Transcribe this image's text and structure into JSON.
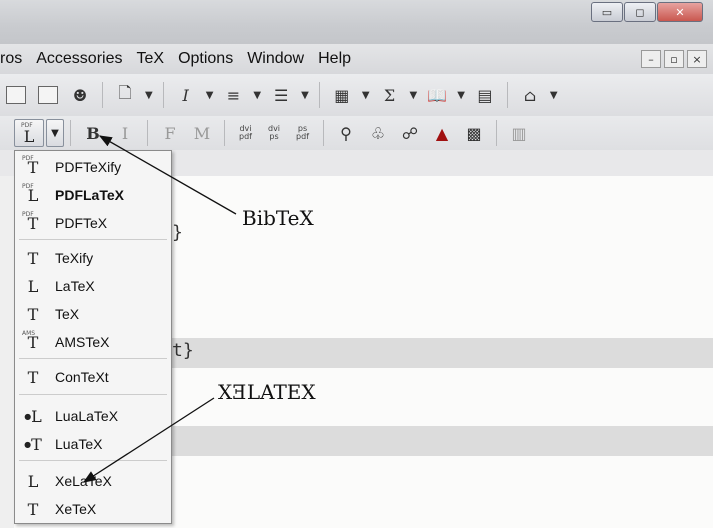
{
  "window": {
    "controls": {
      "minimize": "▭",
      "maximize": "◻",
      "close": "✕"
    }
  },
  "menubar": {
    "items": [
      "ros",
      "Accessories",
      "TeX",
      "Options",
      "Window",
      "Help"
    ],
    "mdi": {
      "minimize": "–",
      "restore": "▫",
      "close": "×"
    }
  },
  "toolbar2": {
    "bold": "B",
    "italic": "I",
    "font_f": "F",
    "font_m": "M",
    "dvi_pdf_top": "dvi",
    "dvi_pdf_bottom": "pdf",
    "dvi_ps_top": "dvi",
    "dvi_ps_bottom": "ps",
    "ps_pdf_top": "ps",
    "ps_pdf_bottom": "pdf"
  },
  "compile_button": {
    "sup": "PDF",
    "glyph": "L"
  },
  "dropdown": {
    "items": [
      {
        "label": "PDFTeXify",
        "glyph": "T",
        "sup": "PDF",
        "bold": false
      },
      {
        "label": "PDFLaTeX",
        "glyph": "L",
        "sup": "PDF",
        "bold": true
      },
      {
        "label": "PDFTeX",
        "glyph": "T",
        "sup": "PDF",
        "bold": false
      },
      {
        "label": "TeXify",
        "glyph": "T",
        "sup": "",
        "bold": false
      },
      {
        "label": "LaTeX",
        "glyph": "L",
        "sup": "",
        "bold": false
      },
      {
        "label": "TeX",
        "glyph": "T",
        "sup": "",
        "bold": false
      },
      {
        "label": "AMSTeX",
        "glyph": "T",
        "sup": "AMS",
        "bold": false
      },
      {
        "label": "ConTeXt",
        "glyph": "T",
        "sup": "",
        "bold": false
      },
      {
        "label": "LuaLaTeX",
        "glyph": "L",
        "sup": "",
        "bold": false
      },
      {
        "label": "LuaTeX",
        "glyph": "T",
        "sup": "",
        "bold": false
      },
      {
        "label": "XeLaTeX",
        "glyph": "L",
        "sup": "",
        "bold": false
      },
      {
        "label": "XeTeX",
        "glyph": "T",
        "sup": "",
        "bold": false
      }
    ]
  },
  "editor": {
    "code_lines": [
      "}",
      "t}"
    ]
  },
  "annotations": {
    "bibtex": "BibTeX",
    "xelatex": "XƎLATEX"
  }
}
